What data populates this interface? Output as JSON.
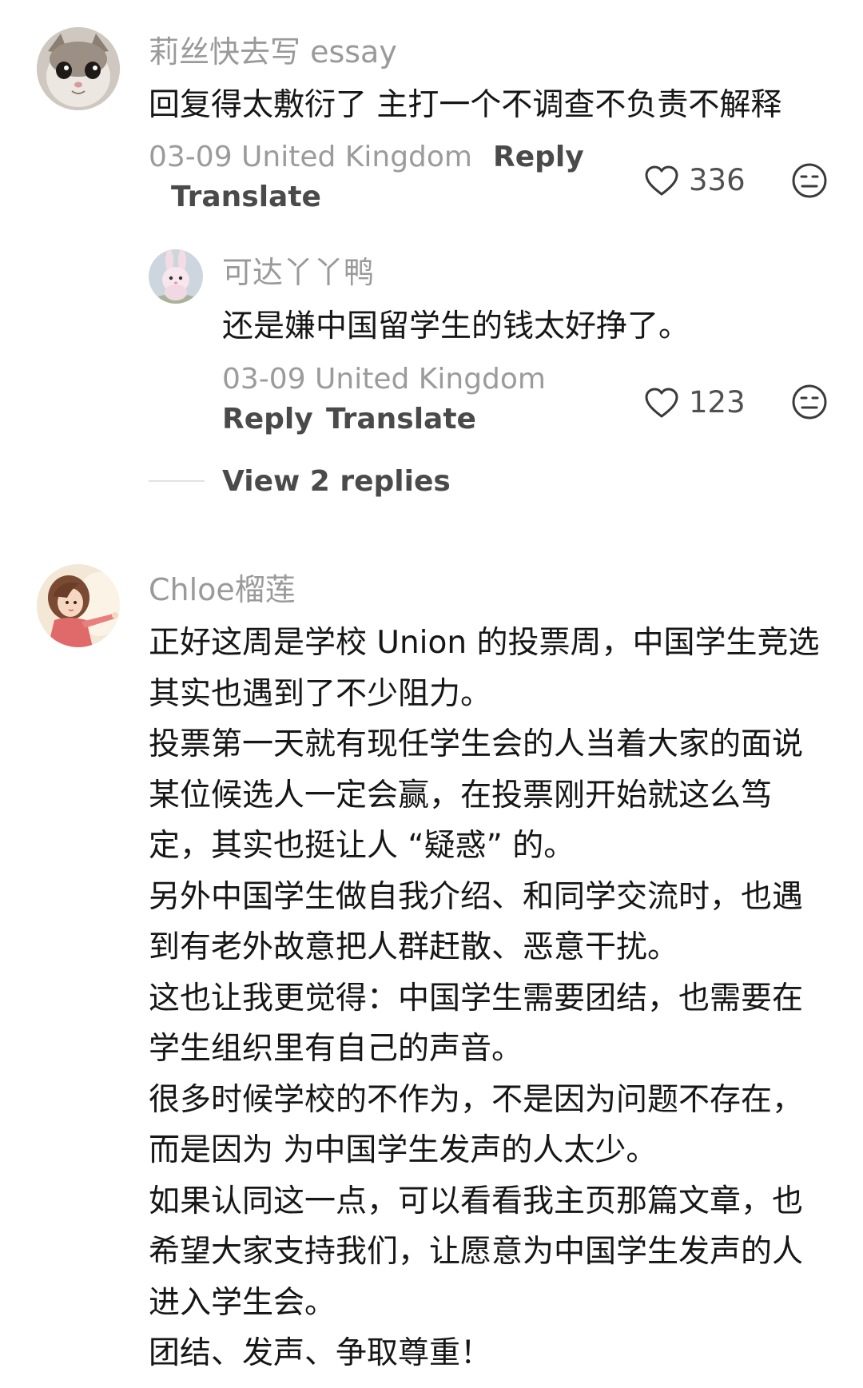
{
  "comments": [
    {
      "username": "莉丝快去写 essay",
      "avatar_icon": "cat-avatar-icon",
      "text": "回复得太敷衍了 主打一个不调查不负责不解释",
      "date_location": "03-09 United Kingdom",
      "reply_label": "Reply",
      "translate_label": "Translate",
      "likes": "336",
      "replies": [
        {
          "username": "可达丫丫鸭",
          "avatar_icon": "bunny-avatar-icon",
          "text": "还是嫌中国留学生的钱太好挣了。",
          "date_location": "03-09 United Kingdom",
          "reply_label": "Reply",
          "translate_label": "Translate",
          "likes": "123"
        }
      ],
      "view_replies_label": "View 2 replies"
    },
    {
      "username": "Chloe榴莲",
      "avatar_icon": "girl-avatar-icon",
      "lines": [
        "正好这周是学校 Union 的投票周，中国学生竞选",
        "其实也遇到了不少阻力。",
        "投票第一天就有现任学生会的人当着大家的面说",
        "某位候选人一定会赢，在投票刚开始就这么笃",
        "定，其实也挺让人 “疑惑” 的。",
        "另外中国学生做自我介绍、和同学交流时，也遇",
        "到有老外故意把人群赶散、恶意干扰。",
        "这也让我更觉得：中国学生需要团结，也需要在",
        "学生组织里有自己的声音。",
        "很多时候学校的不作为，不是因为问题不存在，",
        "而是因为 为中国学生发声的人太少。",
        "如果认同这一点，可以看看我主页那篇文章，也",
        "希望大家支持我们，让愿意为中国学生发声的人",
        "进入学生会。",
        "团结、发声、争取尊重！"
      ]
    }
  ],
  "colors": {
    "username": "#9a9a9a",
    "text": "#161616",
    "meta": "#9b9b9b",
    "action": "#4a4a4a"
  }
}
